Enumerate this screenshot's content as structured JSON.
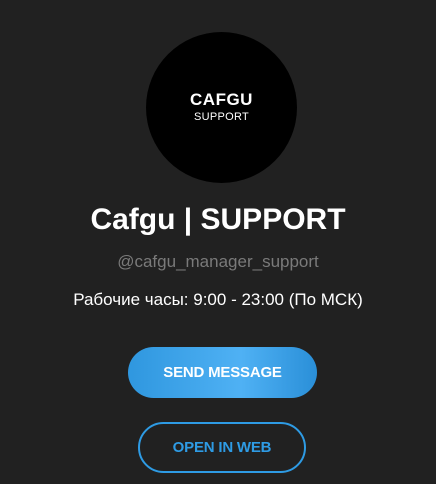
{
  "profile": {
    "avatar": {
      "brand_text": "CAFGU",
      "sub_text": "SUPPORT"
    },
    "name": "Cafgu | SUPPORT",
    "username": "@cafgu_manager_support",
    "description": "Рабочие часы: 9:00 - 23:00 (По МСК)"
  },
  "actions": {
    "send_message_label": "SEND MESSAGE",
    "open_in_web_label": "OPEN IN WEB"
  },
  "colors": {
    "background": "#212121",
    "accent": "#2e9be4",
    "muted_text": "#7a7a7a"
  }
}
